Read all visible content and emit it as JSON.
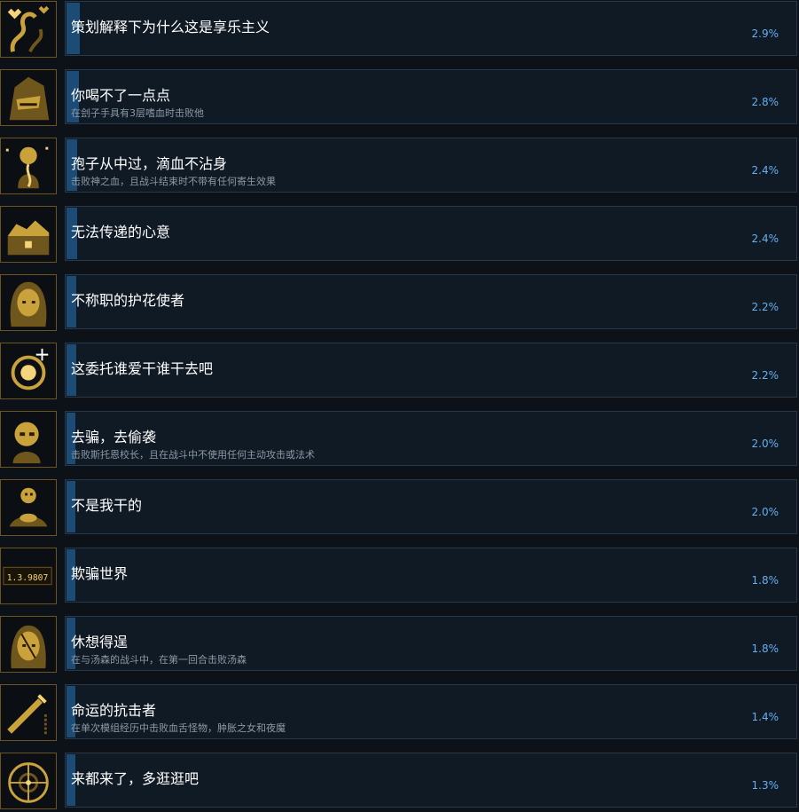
{
  "colors": {
    "background": "#0d1219",
    "panel": "#101a25",
    "panel_border": "#26384a",
    "progress_fill": "#1c4c76",
    "title_text": "#ffffff",
    "desc_text": "#8d99a6",
    "percent_text": "#66aef0",
    "icon_gold": "#c9a23c"
  },
  "achievements": [
    {
      "icon": "tentacle-hearts-icon",
      "title": "策划解释下为什么这是享乐主义",
      "desc": "",
      "percent": "2.9%",
      "progress": 0.029
    },
    {
      "icon": "hooded-executioner-icon",
      "title": "你喝不了一点点",
      "desc": "在刽子手具有3层嗜血时击败他",
      "percent": "2.8%",
      "progress": 0.028
    },
    {
      "icon": "blood-spirit-icon",
      "title": "孢子从中过，滴血不沾身",
      "desc": "击败神之血，且战斗结束时不带有任何寄生效果",
      "percent": "2.4%",
      "progress": 0.024
    },
    {
      "icon": "broken-chest-icon",
      "title": "无法传递的心意",
      "desc": "",
      "percent": "2.4%",
      "progress": 0.024
    },
    {
      "icon": "long-haired-girl-icon",
      "title": "不称职的护花使者",
      "desc": "",
      "percent": "2.2%",
      "progress": 0.022
    },
    {
      "icon": "glowing-orb-icon",
      "title": "这委托谁爱干谁干去吧",
      "desc": "",
      "percent": "2.2%",
      "progress": 0.022
    },
    {
      "icon": "headmaster-icon",
      "title": "去骗，去偷袭",
      "desc": "击败斯托恩校长，且在战斗中不使用任何主动攻击或法术",
      "percent": "2.0%",
      "progress": 0.02
    },
    {
      "icon": "skull-pile-icon",
      "title": "不是我干的",
      "desc": "",
      "percent": "2.0%",
      "progress": 0.02
    },
    {
      "icon": "counter-display-icon",
      "title": "欺骗世界",
      "desc": "",
      "percent": "1.8%",
      "progress": 0.018,
      "icon_text": "1.3.9807"
    },
    {
      "icon": "scarred-face-icon",
      "title": "休想得逞",
      "desc": "在与汤森的战斗中，在第一回合击败汤森",
      "percent": "1.8%",
      "progress": 0.018
    },
    {
      "icon": "sword-chain-icon",
      "title": "命运的抗击者",
      "desc": "在单次模组经历中击败血舌怪物，肿胀之女和夜魔",
      "percent": "1.4%",
      "progress": 0.014
    },
    {
      "icon": "compass-wheel-icon",
      "title": "来都来了，多逛逛吧",
      "desc": "",
      "percent": "1.3%",
      "progress": 0.013
    }
  ]
}
